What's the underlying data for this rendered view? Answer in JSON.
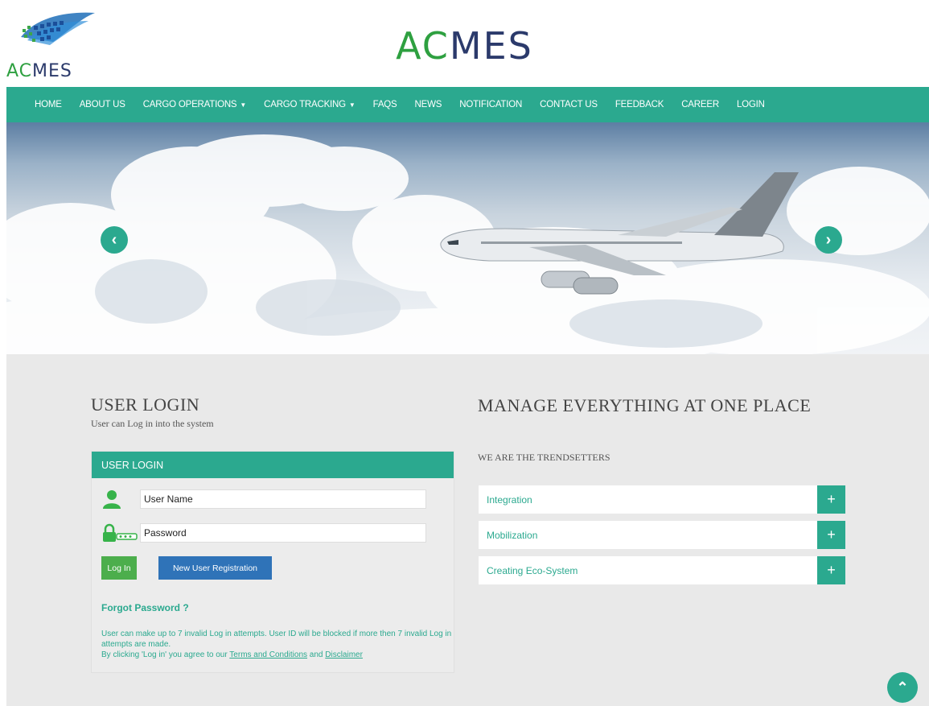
{
  "header": {
    "logo_text_a": "AC",
    "logo_text_b": "MES",
    "title_a": "AC",
    "title_b": "MES"
  },
  "nav": {
    "items": [
      {
        "label": "HOME"
      },
      {
        "label": "ABOUT US"
      },
      {
        "label": "CARGO OPERATIONS"
      },
      {
        "label": "CARGO TRACKING"
      },
      {
        "label": "FAQS"
      },
      {
        "label": "NEWS"
      },
      {
        "label": "NOTIFICATION"
      },
      {
        "label": "CONTACT US"
      },
      {
        "label": "FEEDBACK"
      },
      {
        "label": "CAREER"
      },
      {
        "label": "LOGIN"
      }
    ],
    "caret": "▼"
  },
  "hero": {
    "prev": "‹",
    "next": "›"
  },
  "login": {
    "title": "USER LOGIN",
    "subtitle": "User can Log in into the system",
    "panel_title": "USER LOGIN",
    "username_value": "User Name",
    "password_value": "Password",
    "login_button": "Log In",
    "register_button": "New User Registration",
    "forgot": "Forgot Password ?",
    "note_line1": "User can make up to 7 invalid Log in attempts. User ID will be blocked if more then 7 invalid Log in attempts are made.",
    "note_line2_prefix": "By clicking 'Log in' you agree to our ",
    "terms_link": "Terms and Conditions",
    "note_and": " and ",
    "disclaimer_link": "Disclaimer"
  },
  "manage": {
    "title": "MANAGE EVERYTHING AT ONE PLACE",
    "subtitle": "WE ARE THE TRENDSETTERS",
    "items": [
      {
        "label": "Integration"
      },
      {
        "label": "Mobilization"
      },
      {
        "label": "Creating Eco-System"
      }
    ],
    "plus": "+"
  },
  "scroll_top": "⌃",
  "colors": {
    "primary": "#2ba98f",
    "login_button": "#4cae4c",
    "register_button": "#2f73b8",
    "logo_green": "#2ea040",
    "logo_navy": "#2b3a6b"
  }
}
